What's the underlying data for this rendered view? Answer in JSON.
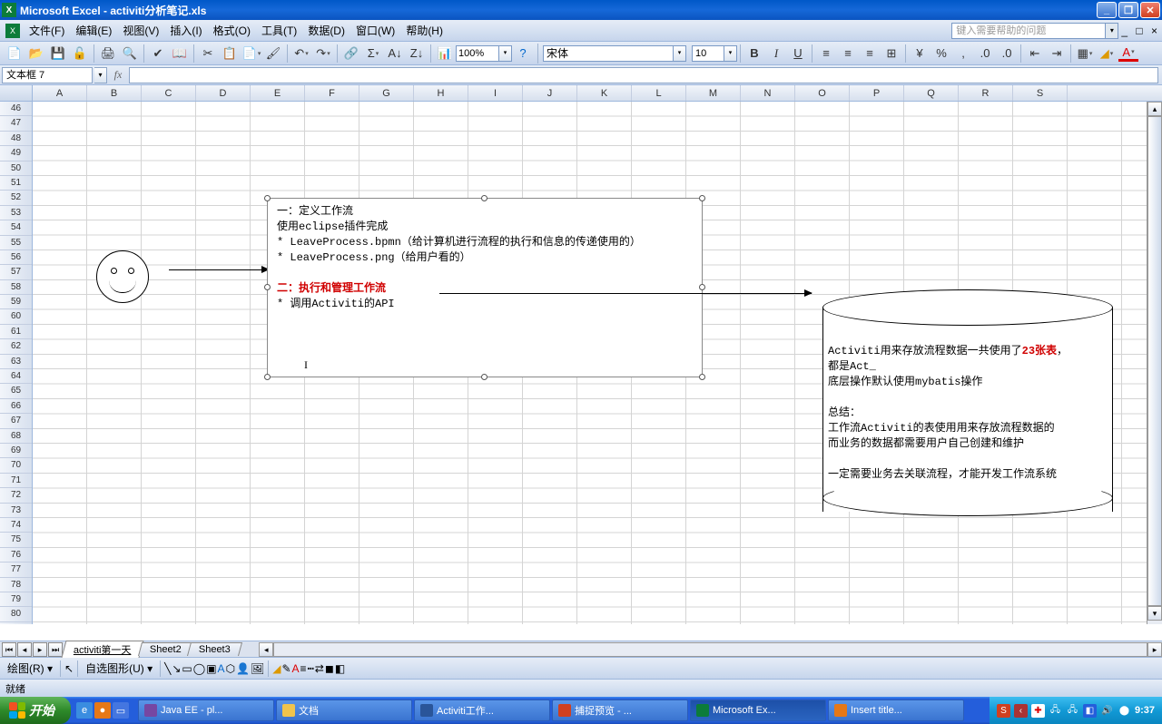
{
  "title": "Microsoft Excel - activiti分析笔记.xls",
  "menu": {
    "file": "文件(F)",
    "edit": "编辑(E)",
    "view": "视图(V)",
    "insert": "插入(I)",
    "format": "格式(O)",
    "tools": "工具(T)",
    "data": "数据(D)",
    "window": "窗口(W)",
    "help": "帮助(H)"
  },
  "helpbox": "键入需要帮助的问题",
  "zoom": "100%",
  "font": {
    "name": "宋体",
    "size": "10"
  },
  "namebox": "文本框 7",
  "cols": [
    "A",
    "B",
    "C",
    "D",
    "E",
    "F",
    "G",
    "H",
    "I",
    "J",
    "K",
    "L",
    "M",
    "N",
    "O",
    "P",
    "Q",
    "R",
    "S"
  ],
  "rows_start": 46,
  "rows_end": 80,
  "textbox1": {
    "l1": "一：定义工作流",
    "l2": "使用eclipse插件完成",
    "l3": "* LeaveProcess.bpmn（给计算机进行流程的执行和信息的传递使用的）",
    "l4": "* LeaveProcess.png（给用户看的）",
    "l5": "二：执行和管理工作流",
    "l6": "* 调用Activiti的API"
  },
  "cylinder": {
    "l1a": "Activiti用来存放流程数据一共使用了",
    "l1b": "23张表",
    "l1c": "，",
    "l2": "都是Act_",
    "l3": "底层操作默认使用mybatis操作",
    "l4": "总结：",
    "l5": "工作流Activiti的表使用用来存放流程数据的",
    "l6": "而业务的数据都需要用户自己创建和维护",
    "l7": "一定需要业务去关联流程，才能开发工作流系统"
  },
  "sheets": {
    "s1": "activiti第一天",
    "s2": "Sheet2",
    "s3": "Sheet3"
  },
  "drawbar": {
    "draw": "绘图(R)",
    "autoshape": "自选图形(U)"
  },
  "status": "就绪",
  "taskbar": {
    "start": "开始",
    "t1": "Java EE - pl...",
    "t2": "文档",
    "t3": "Activiti工作...",
    "t4": "捕捉预览 - ...",
    "t5": "Microsoft Ex...",
    "t6": "Insert title...",
    "clock": "9:37"
  }
}
